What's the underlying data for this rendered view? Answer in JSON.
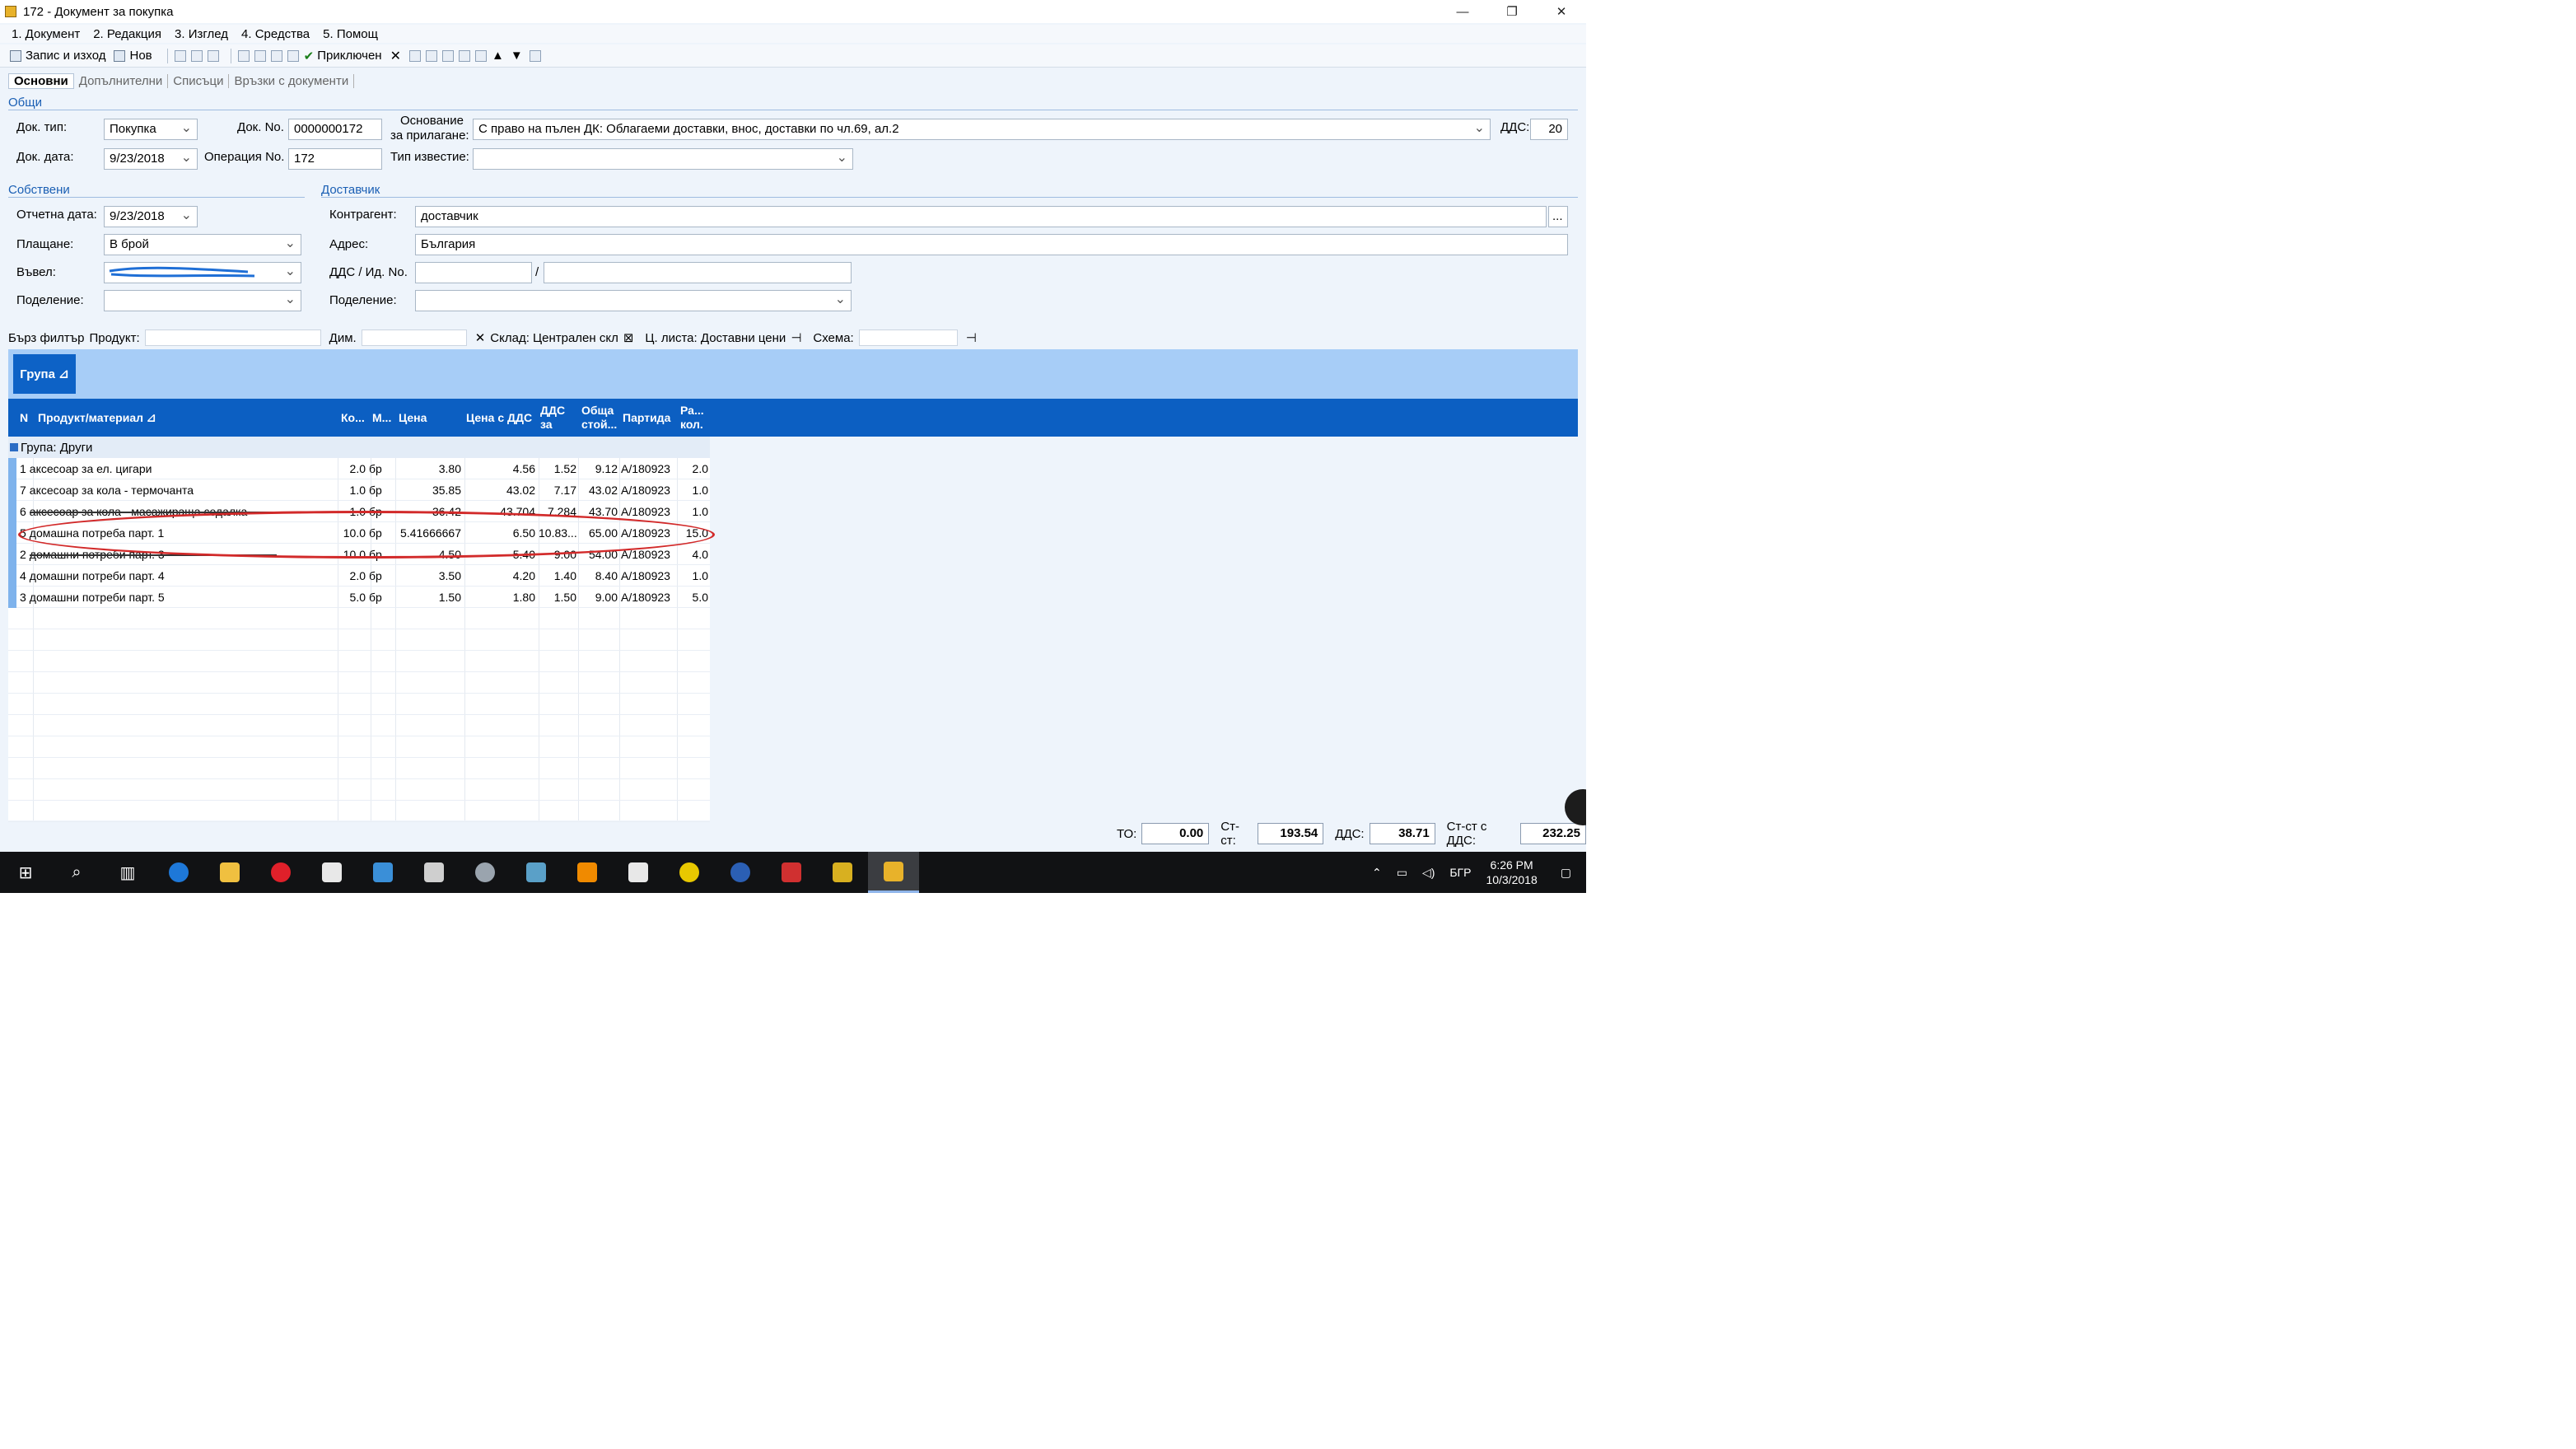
{
  "window": {
    "title": "172 - Документ за покупка"
  },
  "menu": [
    "1. Документ",
    "2. Редакция",
    "3. Изглед",
    "4. Средства",
    "5. Помощ"
  ],
  "toolbar": {
    "save_exit": "Запис и изход",
    "new": "Нов",
    "completed": "Приключен"
  },
  "tabs": [
    "Основни",
    "Допълнителни",
    "Списъци",
    "Връзки с документи"
  ],
  "sections": {
    "general": "Общи",
    "own": "Собствени",
    "supplier": "Доставчик"
  },
  "form": {
    "doc_type_label": "Док. тип:",
    "doc_type": "Покупка",
    "doc_no_label": "Док. No.",
    "doc_no": "0000000172",
    "basis_label_1": "Основание",
    "basis_label_2": "за прилагане:",
    "basis": "С право на пълен ДК: Облагаеми доставки, внос, доставки по чл.69, ал.2",
    "vat_label": "ДДС:",
    "vat": "20",
    "doc_date_label": "Док. дата:",
    "doc_date": "9/23/2018",
    "operation_label": "Операция No.",
    "operation": "172",
    "notice_label": "Тип известие:",
    "report_date_label": "Отчетна дата:",
    "report_date": "9/23/2018",
    "payment_label": "Плащане:",
    "payment": "В брой",
    "entered_label": "Въвел:",
    "division_label": "Поделение:",
    "contractor_label": "Контрагент:",
    "contractor": "доставчик",
    "address_label": "Адрес:",
    "address": "България",
    "vatid_label": "ДДС / Ид. No.",
    "vatid_sep": "/",
    "division2_label": "Поделение:"
  },
  "filter": {
    "quick": "Бърз филтър",
    "product": "Продукт:",
    "dim": "Дим.",
    "warehouse": "Склад: Централен скл",
    "pricelist": "Ц. листа: Доставни цени",
    "scheme": "Схема:"
  },
  "group_chip": "Група ⊿",
  "columns": [
    "N",
    "Продукт/материал ⊿",
    "Ко...",
    "М...",
    "Цена",
    "Цена с ДДС",
    "ДДС за",
    "Обща стой...",
    "Партида",
    "Ра... кол."
  ],
  "group_row": "Група: Други",
  "rows": [
    {
      "n": "1",
      "name": "аксесоар за ел. цигари",
      "qty": "2.0",
      "unit": "бр",
      "price": "3.80",
      "price_vat": "4.56",
      "vat": "1.52",
      "total": "9.12",
      "batch": "A/180923",
      "avail": "2.0"
    },
    {
      "n": "7",
      "name": "аксесоар за кола - термочанта",
      "qty": "1.0",
      "unit": "бр",
      "price": "35.85",
      "price_vat": "43.02",
      "vat": "7.17",
      "total": "43.02",
      "batch": "A/180923",
      "avail": "1.0"
    },
    {
      "n": "6",
      "name": "аксесоар за кола - масажираща седалка",
      "qty": "1.0",
      "unit": "бр",
      "price": "36.42",
      "price_vat": "43.704",
      "vat": "7.284",
      "total": "43.70",
      "batch": "A/180923",
      "avail": "1.0"
    },
    {
      "n": "5",
      "name": "домашна потреба парт. 1",
      "qty": "10.0",
      "unit": "бр",
      "price": "5.41666667",
      "price_vat": "6.50",
      "vat": "10.83...",
      "total": "65.00",
      "batch": "A/180923",
      "avail": "15.0"
    },
    {
      "n": "2",
      "name": "домашни потреби парт. 3",
      "qty": "10.0",
      "unit": "бр",
      "price": "4.50",
      "price_vat": "5.40",
      "vat": "9.00",
      "total": "54.00",
      "batch": "A/180923",
      "avail": "4.0"
    },
    {
      "n": "4",
      "name": "домашни потреби парт. 4",
      "qty": "2.0",
      "unit": "бр",
      "price": "3.50",
      "price_vat": "4.20",
      "vat": "1.40",
      "total": "8.40",
      "batch": "A/180923",
      "avail": "1.0"
    },
    {
      "n": "3",
      "name": "домашни потреби парт. 5",
      "qty": "5.0",
      "unit": "бр",
      "price": "1.50",
      "price_vat": "1.80",
      "vat": "1.50",
      "total": "9.00",
      "batch": "A/180923",
      "avail": "5.0"
    }
  ],
  "totals": {
    "to_label": "ТО:",
    "to": "0.00",
    "net_label": "Ст-ст:",
    "net": "193.54",
    "vat_label": "ДДС:",
    "vat": "38.71",
    "gross_label": "Ст-ст с ДДС:",
    "gross": "232.25"
  },
  "taskbar": {
    "lang": "БГР",
    "time": "6:26 PM",
    "date": "10/3/2018"
  },
  "colors": {
    "accent": "#0c5fc2",
    "groupbar": "#a7cdf7",
    "annotation": "#d22a2a"
  }
}
